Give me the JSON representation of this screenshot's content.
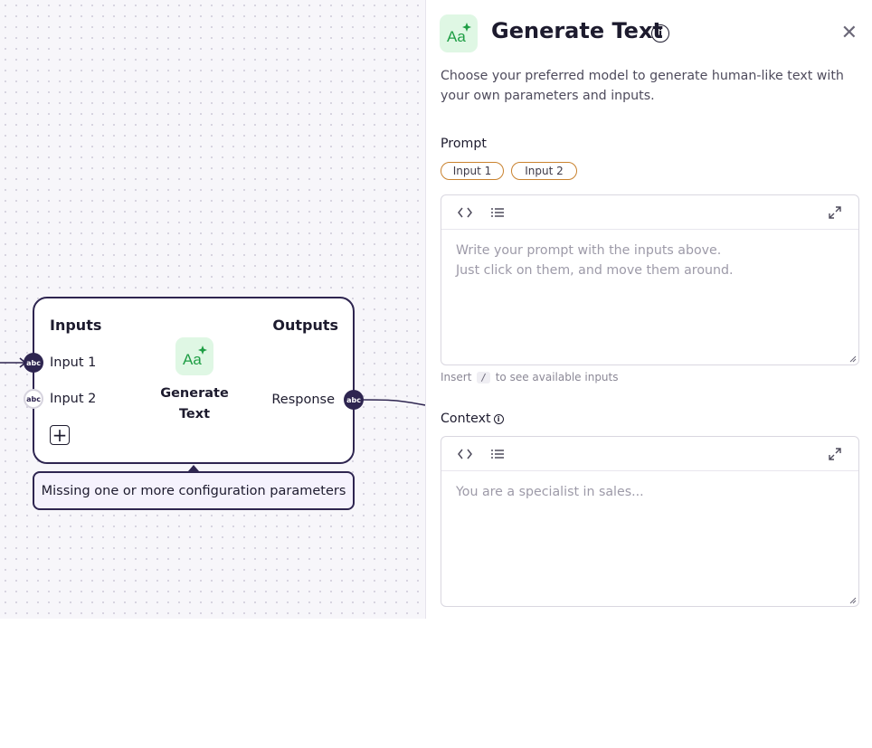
{
  "canvas": {
    "node": {
      "inputs_title": "Inputs",
      "outputs_title": "Outputs",
      "inputs": [
        {
          "label": "Input 1",
          "type_badge": "abc"
        },
        {
          "label": "Input 2",
          "type_badge": "abc"
        }
      ],
      "outputs": [
        {
          "label": "Response",
          "type_badge": "abc"
        }
      ],
      "title_line1": "Generate",
      "title_line2": "Text",
      "add_button": "+"
    },
    "tooltip": "Missing one or more configuration parameters"
  },
  "panel": {
    "title": "Generate Text",
    "info_symbol": "i",
    "close_symbol": "✕",
    "description": "Choose your preferred model to generate human-like text with your own parameters and inputs.",
    "prompt": {
      "label": "Prompt",
      "chips": [
        "Input 1",
        "Input 2"
      ],
      "placeholder": "Write your prompt with the inputs above.\nJust click on them, and move them around.",
      "hint_before": "Insert",
      "hint_key": "/",
      "hint_after": "to see available inputs"
    },
    "context": {
      "label": "Context",
      "placeholder": "You are a specialist in sales..."
    }
  },
  "icons": [
    "generate-text-icon",
    "info-icon",
    "close-icon",
    "code-icon",
    "list-icon",
    "expand-icon",
    "plus-icon"
  ],
  "colors": {
    "node_border": "#2e2550",
    "icon_green": "#1f9e45",
    "icon_bg": "#dff7e4",
    "chip_border": "#c9822e"
  }
}
